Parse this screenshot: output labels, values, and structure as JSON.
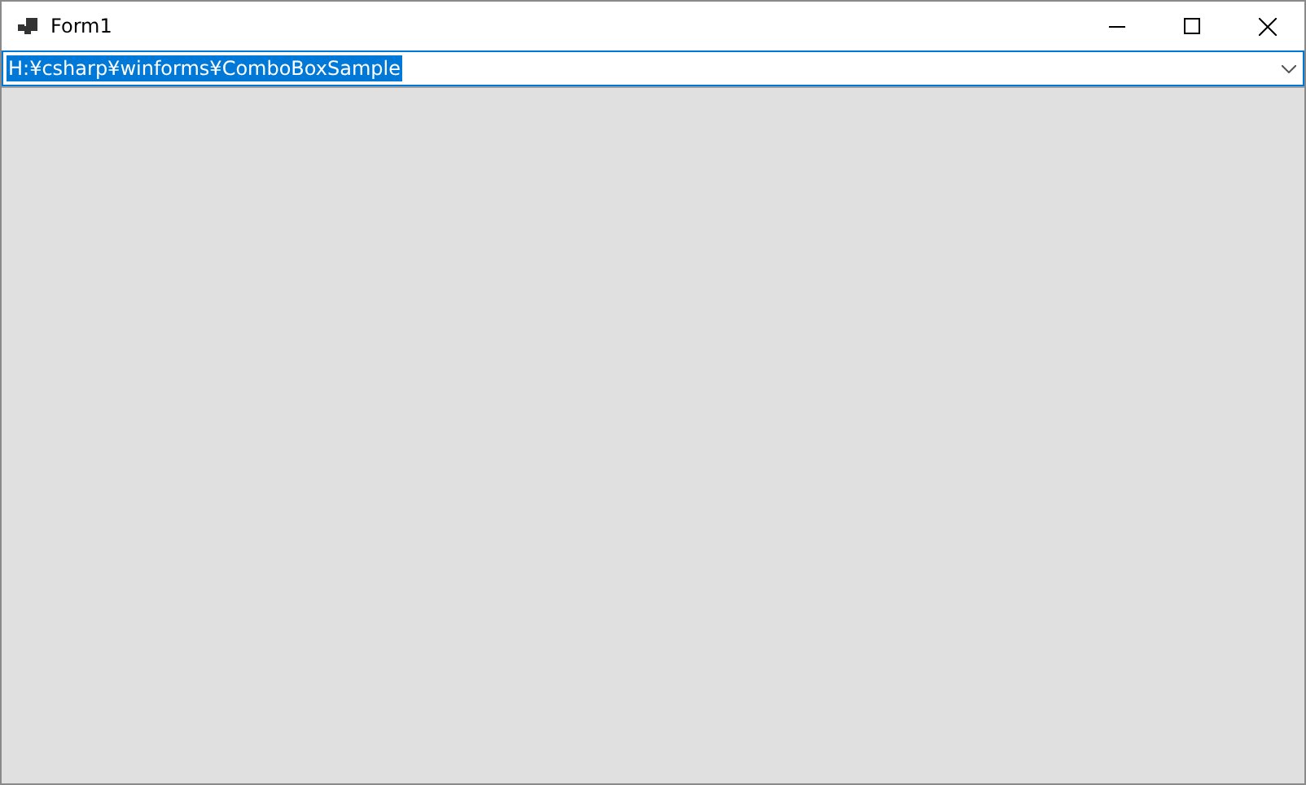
{
  "window": {
    "title": "Form1"
  },
  "combo_box": {
    "value": "H:¥csharp¥winforms¥ComboBoxSample",
    "text_highlighted": true
  }
}
